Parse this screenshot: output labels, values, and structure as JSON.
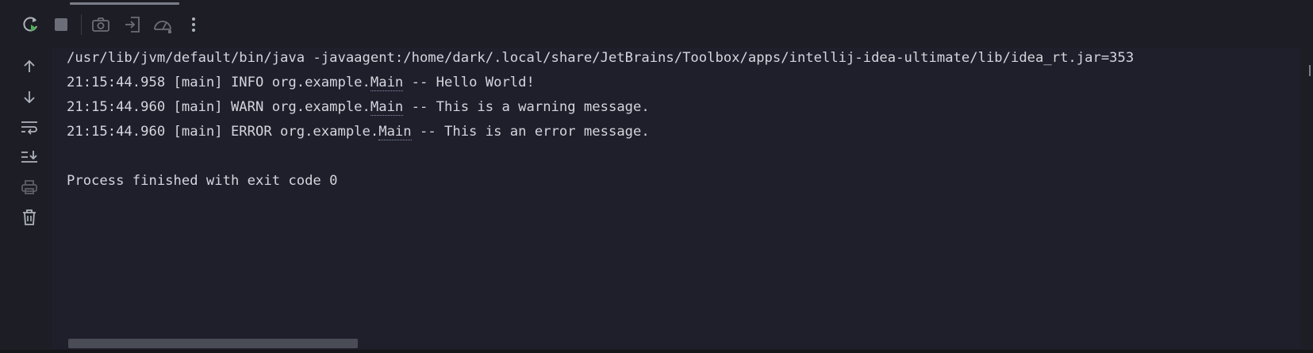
{
  "toolbar": {
    "rerun": "rerun-icon",
    "stop": "stop-icon",
    "screenshot": "camera-icon",
    "exit": "exit-icon",
    "profiler": "gauge-icon",
    "more": "more-vertical-icon"
  },
  "gutter": {
    "up": "arrow-up-icon",
    "down": "arrow-down-icon",
    "wrap": "soft-wrap-icon",
    "scroll_end": "scroll-to-end-icon",
    "print": "print-icon",
    "clear": "trash-icon"
  },
  "console": {
    "command": "/usr/lib/jvm/default/bin/java -javaagent:/home/dark/.local/share/JetBrains/Toolbox/apps/intellij-idea-ultimate/lib/idea_rt.jar=353",
    "logs": [
      {
        "prefix": "21:15:44.958 [main] INFO org.example.",
        "class_link": "Main",
        "message": " -- Hello World!"
      },
      {
        "prefix": "21:15:44.960 [main] WARN org.example.",
        "class_link": "Main",
        "message": " -- This is a warning message."
      },
      {
        "prefix": "21:15:44.960 [main] ERROR org.example.",
        "class_link": "Main",
        "message": " -- This is an error message."
      }
    ],
    "exit_message": "Process finished with exit code 0"
  },
  "colors": {
    "background": "#1e1f2b",
    "text": "#d4d6dc",
    "icon": "#aeb3bd",
    "run_green": "#4caf50"
  }
}
